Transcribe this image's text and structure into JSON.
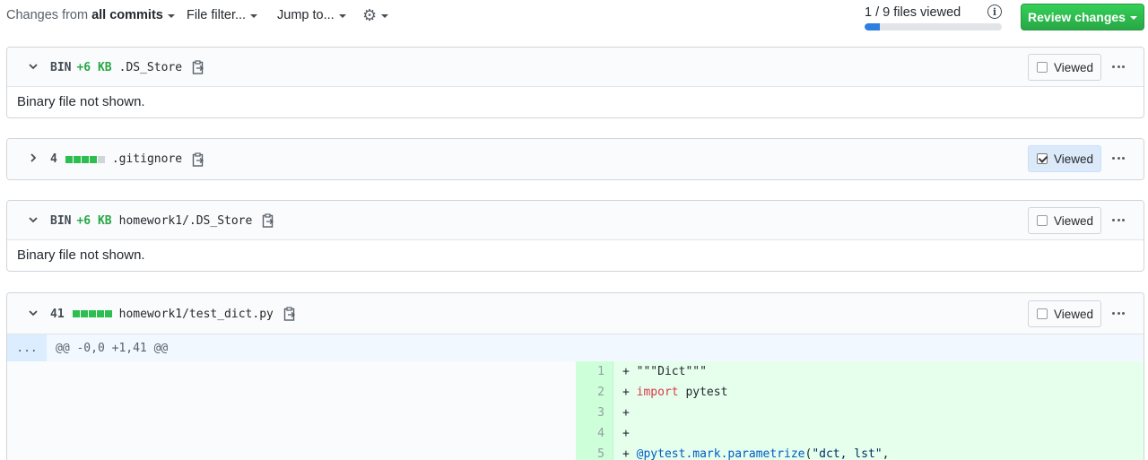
{
  "toolbar": {
    "changes_prefix": "Changes from",
    "changes_value": "all commits",
    "file_filter": "File filter...",
    "jump_to": "Jump to...",
    "settings_icon": "gear-icon",
    "files_viewed": "1 / 9 files viewed",
    "files_viewed_progress": 0.11,
    "info_icon": "info-icon",
    "review_changes": "Review changes"
  },
  "colors": {
    "accent_green": "#28a745",
    "progress_blue": "#2f7ee0",
    "added_bg": "#e6ffed"
  },
  "files": [
    {
      "expanded": true,
      "type_label": "BIN",
      "size": "+6 KB",
      "name": ".DS_Store",
      "viewed_label": "Viewed",
      "viewed": false,
      "body": "Binary file not shown."
    },
    {
      "expanded": false,
      "count": "4",
      "name": ".gitignore",
      "viewed_label": "Viewed",
      "viewed": true
    },
    {
      "expanded": true,
      "type_label": "BIN",
      "size": "+6 KB",
      "name": "homework1/.DS_Store",
      "viewed_label": "Viewed",
      "viewed": false,
      "body": "Binary file not shown."
    },
    {
      "expanded": true,
      "count": "41",
      "name": "homework1/test_dict.py",
      "viewed_label": "Viewed",
      "viewed": false
    }
  ],
  "diff": {
    "expand_label": "...",
    "hunk_header": "@@ -0,0 +1,41 @@",
    "lines": [
      {
        "num": "1",
        "prefix": "+ ",
        "parts": [
          [
            "",
            "\"\"\"Dict\"\"\""
          ]
        ]
      },
      {
        "num": "2",
        "prefix": "+ ",
        "parts": [
          [
            "kw",
            "import"
          ],
          [
            "",
            " pytest"
          ]
        ]
      },
      {
        "num": "3",
        "prefix": "+ ",
        "parts": []
      },
      {
        "num": "4",
        "prefix": "+ ",
        "parts": []
      },
      {
        "num": "5",
        "prefix": "+ ",
        "parts": [
          [
            "dec",
            "@pytest.mark.parametrize"
          ],
          [
            "",
            "("
          ],
          [
            "str",
            "\"dct, lst\""
          ],
          [
            "",
            ","
          ]
        ]
      }
    ]
  }
}
